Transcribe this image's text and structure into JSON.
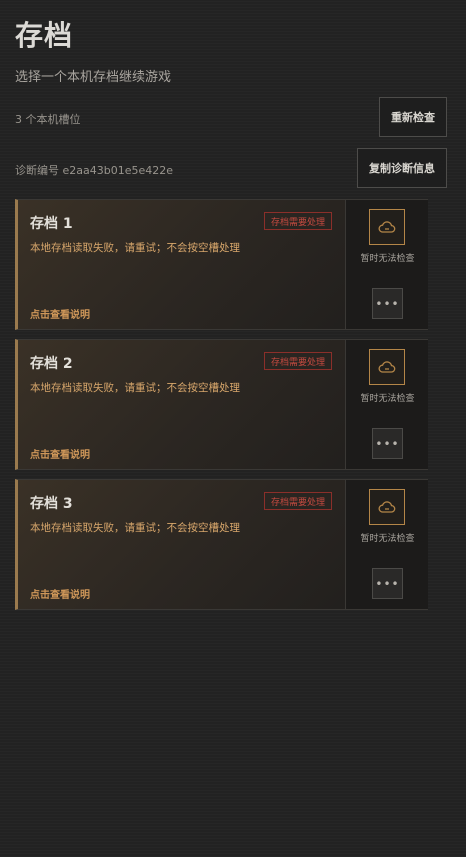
{
  "header": {
    "title": "存档",
    "subtitle": "选择一个本机存档继续游戏"
  },
  "local_slots": {
    "count_text": "3 个本机槽位",
    "recheck_label": "重新检查"
  },
  "diagnostics": {
    "id_text": "诊断编号 e2aa43b01e5e422e",
    "copy_label": "复制诊断信息"
  },
  "slots": [
    {
      "name": "存档 1",
      "badge": "存档需要处理",
      "error": "本地存档读取失败，请重试；不会按空槽处理",
      "link": "点击查看说明",
      "side_caption": "暂时无法检查",
      "more_label": "•••"
    },
    {
      "name": "存档 2",
      "badge": "存档需要处理",
      "error": "本地存档读取失败，请重试；不会按空槽处理",
      "link": "点击查看说明",
      "side_caption": "暂时无法检查",
      "more_label": "•••"
    },
    {
      "name": "存档 3",
      "badge": "存档需要处理",
      "error": "本地存档读取失败，请重试；不会按空槽处理",
      "link": "点击查看说明",
      "side_caption": "暂时无法检查",
      "more_label": "•••"
    }
  ],
  "colors": {
    "accent": "#b48648",
    "error": "#c54a40",
    "warning_text": "#d7a66b"
  },
  "icons": {
    "cloud": "cloud-icon",
    "more": "more-dots-icon"
  }
}
